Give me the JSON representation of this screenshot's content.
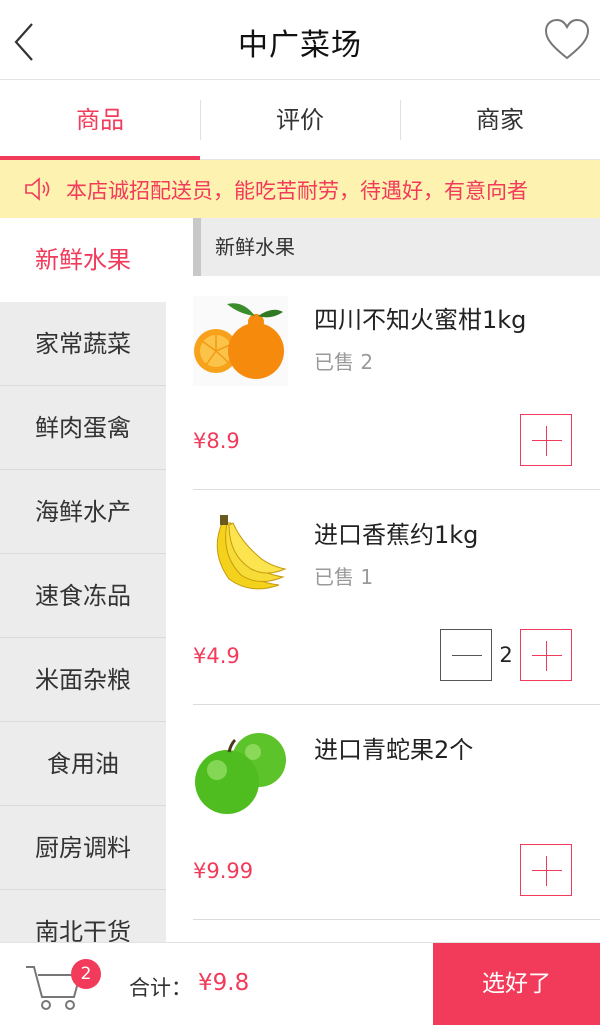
{
  "header": {
    "title": "中广菜场",
    "back_icon": "chevron-left-icon",
    "favorite_icon": "heart-outline-icon"
  },
  "tabs": [
    {
      "label": "商品",
      "active": true
    },
    {
      "label": "评价",
      "active": false
    },
    {
      "label": "商家",
      "active": false
    }
  ],
  "notice": {
    "icon": "speaker-icon",
    "text": "本店诚招配送员，能吃苦耐劳，待遇好，有意向者"
  },
  "sidebar": {
    "items": [
      {
        "label": "新鲜水果",
        "active": true
      },
      {
        "label": "家常蔬菜",
        "active": false
      },
      {
        "label": "鲜肉蛋禽",
        "active": false
      },
      {
        "label": "海鲜水产",
        "active": false
      },
      {
        "label": "速食冻品",
        "active": false
      },
      {
        "label": "米面杂粮",
        "active": false
      },
      {
        "label": "食用油",
        "active": false
      },
      {
        "label": "厨房调料",
        "active": false
      },
      {
        "label": "南北干货",
        "active": false
      }
    ]
  },
  "section": {
    "title": "新鲜水果"
  },
  "products": [
    {
      "name": "四川不知火蜜柑1kg",
      "sold": "已售 2",
      "price": "¥8.9",
      "quantity": null,
      "image": "orange-image"
    },
    {
      "name": "进口香蕉约1kg",
      "sold": "已售 1",
      "price": "¥4.9",
      "quantity": "2",
      "image": "banana-image"
    },
    {
      "name": "进口青蛇果2个",
      "sold": "",
      "price": "¥9.99",
      "quantity": null,
      "image": "green-apple-image"
    }
  ],
  "cart": {
    "icon": "cart-icon",
    "badge": "2",
    "total_label": "合计：",
    "total_value": "¥9.8",
    "checkout_label": "选好了"
  },
  "colors": {
    "accent": "#f23a5a",
    "notice_bg": "#fdf2b0",
    "sidebar_bg": "#ececec"
  }
}
